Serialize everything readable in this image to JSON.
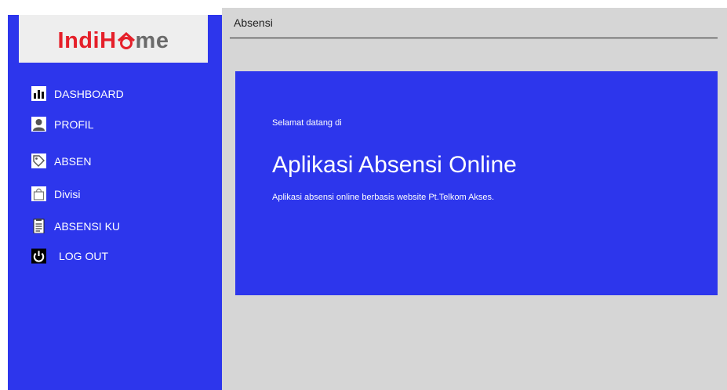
{
  "brand": {
    "logo_part1": "Indi",
    "logo_part2": "H",
    "logo_part3": "me",
    "red": "#e5202a",
    "gray": "#6a6a6a"
  },
  "colors": {
    "sidebar": "#2d36ec",
    "main_bg": "#d6d6d6",
    "hero": "#2d36ec"
  },
  "sidebar": {
    "items": [
      {
        "label": "DASHBOARD",
        "icon": "bar-chart-icon"
      },
      {
        "label": "PROFIL",
        "icon": "user-icon"
      },
      {
        "label": "ABSEN",
        "icon": "tag-icon"
      },
      {
        "label": "Divisi",
        "icon": "shopping-bag-icon"
      },
      {
        "label": "ABSENSI KU",
        "icon": "clipboard-icon"
      },
      {
        "label": "LOG OUT",
        "icon": "power-icon"
      }
    ]
  },
  "header": {
    "title": "Absensi"
  },
  "hero": {
    "welcome": "Selamat datang di",
    "title": "Aplikasi Absensi Online",
    "description": "Aplikasi absensi online berbasis website Pt.Telkom Akses."
  }
}
